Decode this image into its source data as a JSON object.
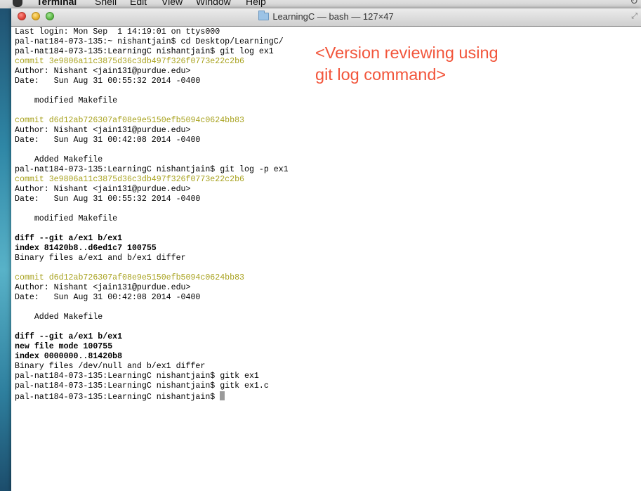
{
  "menubar": {
    "items": [
      "Terminal",
      "Shell",
      "Edit",
      "View",
      "Window",
      "Help"
    ]
  },
  "window": {
    "title": "LearningC — bash — 127×47"
  },
  "terminal": {
    "lines": [
      {
        "text": "Last login: Mon Sep  1 14:19:01 on ttys000",
        "style": "normal"
      },
      {
        "text": "pal-nat184-073-135:~ nishantjain$ cd Desktop/LearningC/",
        "style": "normal"
      },
      {
        "text": "pal-nat184-073-135:LearningC nishantjain$ git log ex1",
        "style": "normal"
      },
      {
        "text": "commit 3e9806a11c3875d36c3db497f326f0773e22c2b6",
        "style": "commit"
      },
      {
        "text": "Author: Nishant <jain131@purdue.edu>",
        "style": "normal"
      },
      {
        "text": "Date:   Sun Aug 31 00:55:32 2014 -0400",
        "style": "normal"
      },
      {
        "text": "",
        "style": "normal"
      },
      {
        "text": "    modified Makefile",
        "style": "normal"
      },
      {
        "text": "",
        "style": "normal"
      },
      {
        "text": "commit d6d12ab726307af08e9e5150efb5094c0624bb83",
        "style": "commit"
      },
      {
        "text": "Author: Nishant <jain131@purdue.edu>",
        "style": "normal"
      },
      {
        "text": "Date:   Sun Aug 31 00:42:08 2014 -0400",
        "style": "normal"
      },
      {
        "text": "",
        "style": "normal"
      },
      {
        "text": "    Added Makefile",
        "style": "normal"
      },
      {
        "text": "pal-nat184-073-135:LearningC nishantjain$ git log -p ex1",
        "style": "normal"
      },
      {
        "text": "commit 3e9806a11c3875d36c3db497f326f0773e22c2b6",
        "style": "commit"
      },
      {
        "text": "Author: Nishant <jain131@purdue.edu>",
        "style": "normal"
      },
      {
        "text": "Date:   Sun Aug 31 00:55:32 2014 -0400",
        "style": "normal"
      },
      {
        "text": "",
        "style": "normal"
      },
      {
        "text": "    modified Makefile",
        "style": "normal"
      },
      {
        "text": "",
        "style": "normal"
      },
      {
        "text": "diff --git a/ex1 b/ex1",
        "style": "bold"
      },
      {
        "text": "index 81420b8..d6ed1c7 100755",
        "style": "bold"
      },
      {
        "text": "Binary files a/ex1 and b/ex1 differ",
        "style": "normal"
      },
      {
        "text": "",
        "style": "normal"
      },
      {
        "text": "commit d6d12ab726307af08e9e5150efb5094c0624bb83",
        "style": "commit"
      },
      {
        "text": "Author: Nishant <jain131@purdue.edu>",
        "style": "normal"
      },
      {
        "text": "Date:   Sun Aug 31 00:42:08 2014 -0400",
        "style": "normal"
      },
      {
        "text": "",
        "style": "normal"
      },
      {
        "text": "    Added Makefile",
        "style": "normal"
      },
      {
        "text": "",
        "style": "normal"
      },
      {
        "text": "diff --git a/ex1 b/ex1",
        "style": "bold"
      },
      {
        "text": "new file mode 100755",
        "style": "bold"
      },
      {
        "text": "index 0000000..81420b8",
        "style": "bold"
      },
      {
        "text": "Binary files /dev/null and b/ex1 differ",
        "style": "normal"
      },
      {
        "text": "pal-nat184-073-135:LearningC nishantjain$ gitk ex1",
        "style": "normal"
      },
      {
        "text": "pal-nat184-073-135:LearningC nishantjain$ gitk ex1.c",
        "style": "normal"
      },
      {
        "text": "pal-nat184-073-135:LearningC nishantjain$ ",
        "style": "prompt"
      }
    ]
  },
  "annotation": {
    "text": "<Version reviewing using\ngit log command>"
  },
  "colors": {
    "commit_hash": "#a8a21e",
    "annotation": "#f2553b"
  },
  "icons": {
    "title_folder": "folder-icon",
    "window_resize": "fullscreen-icon",
    "menubar_right": "time-machine-icon"
  }
}
